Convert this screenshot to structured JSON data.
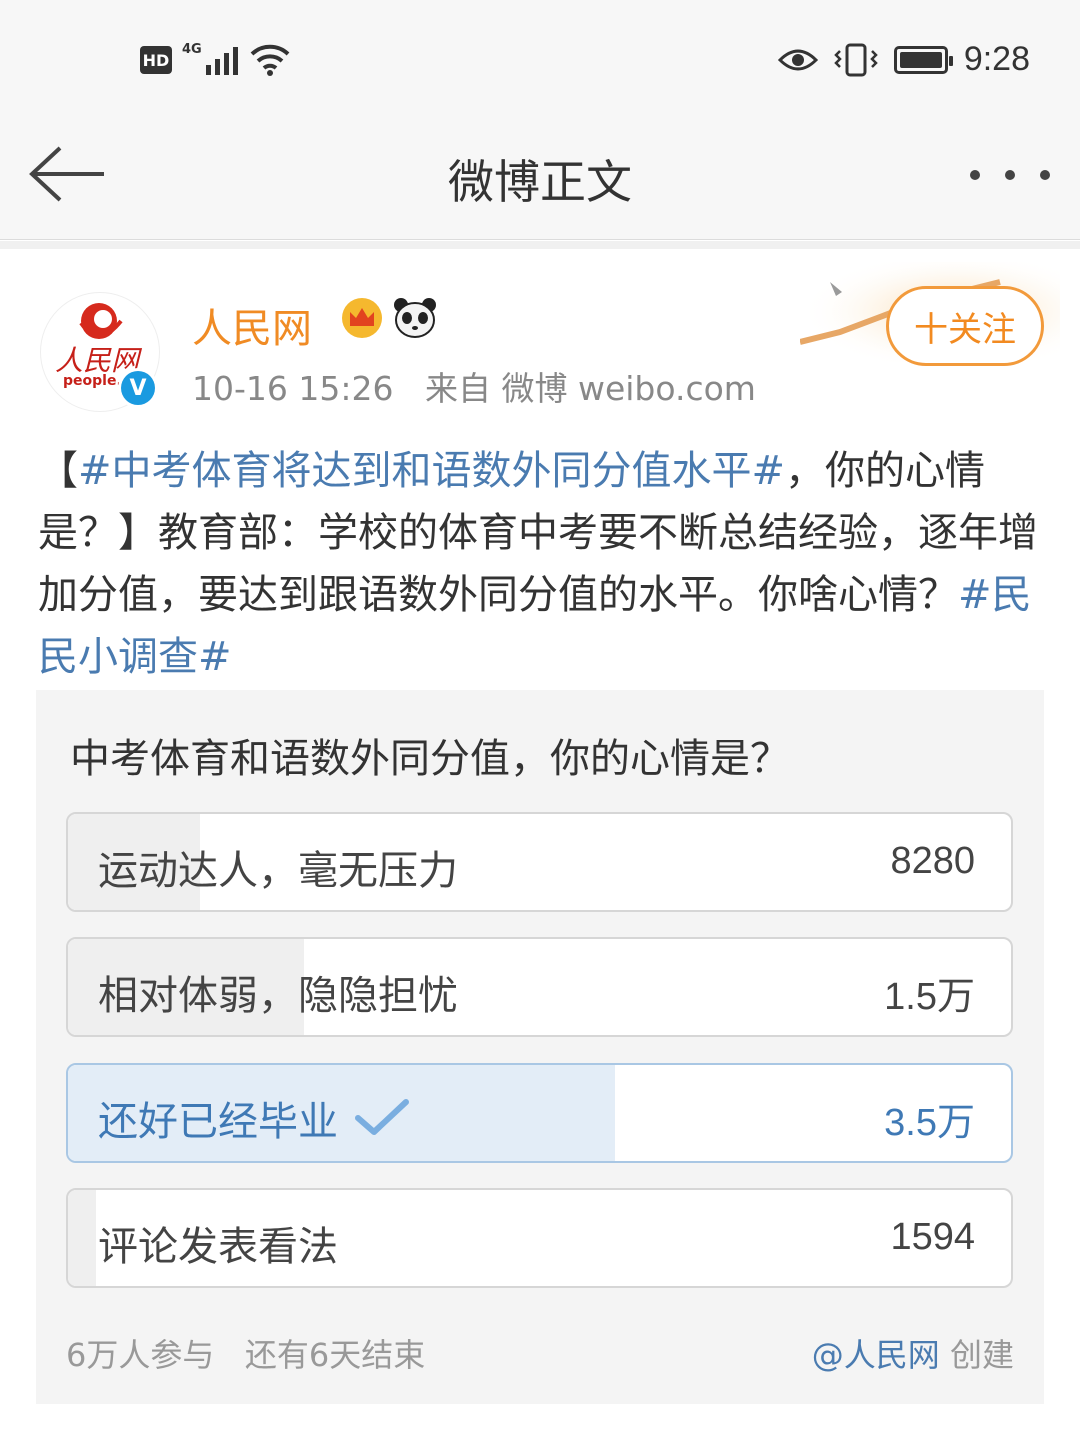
{
  "status_bar": {
    "hd": "HD",
    "network": "4G",
    "time": "9:28"
  },
  "nav": {
    "title": "微博正文"
  },
  "post": {
    "username": "人民网",
    "avatar_text": "人民网",
    "avatar_subtext": "people.c",
    "verified": "V",
    "time": "10-16 15:26",
    "source": "来自 微博 weibo.com",
    "follow_label": "十关注",
    "text": {
      "bracket_open": "【",
      "tag1": "#中考体育将达到和语数外同分值水平#",
      "part1": "，你的心情是？】教育部：学校的体育中考要不断总结经验，逐年增加分值，要达到跟语数外同分值的水平。你啥心情？",
      "tag2": "#民民小调查#"
    }
  },
  "poll": {
    "question": "中考体育和语数外同分值，你的心情是？",
    "options": [
      {
        "label": "运动达人，毫无压力",
        "count": "8280",
        "share": 0.14,
        "selected": false
      },
      {
        "label": "相对体弱，隐隐担忧",
        "count": "1.5万",
        "share": 0.25,
        "selected": false
      },
      {
        "label": "还好已经毕业",
        "count": "3.5万",
        "share": 0.58,
        "selected": true
      },
      {
        "label": "评论发表看法",
        "count": "1594",
        "share": 0.03,
        "selected": false
      }
    ],
    "participants": "6万人参与",
    "remaining": "还有6天结束",
    "creator_link": "@人民网",
    "creator_suffix": "创建"
  },
  "icons": {
    "back": "arrow-left-icon",
    "more": "more-dots-icon",
    "crown": "crown-icon",
    "panda": "panda-icon",
    "check": "checkmark-icon"
  },
  "colors": {
    "accent_orange": "#f28a20",
    "link_blue": "#4a7bb0",
    "selected_bar": "#e3edf7"
  }
}
